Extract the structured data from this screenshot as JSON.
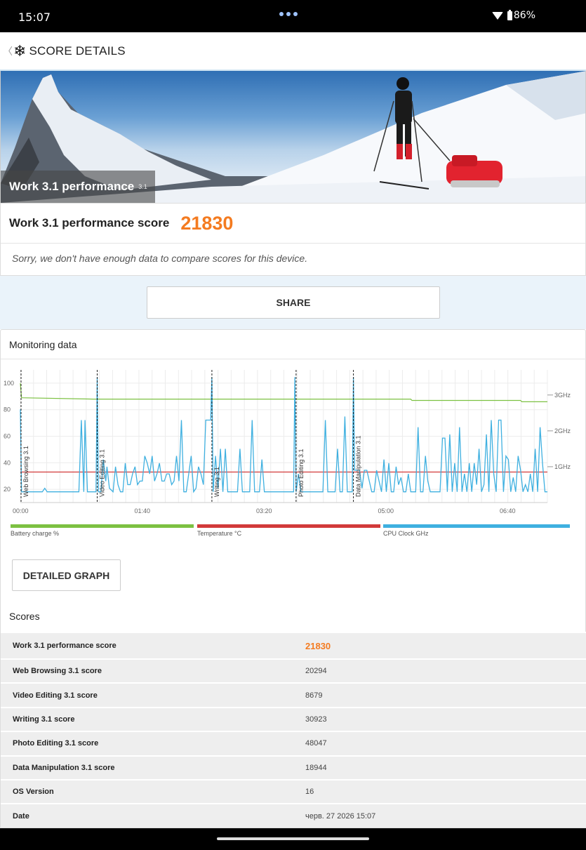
{
  "status": {
    "time": "15:07",
    "battery": "86%"
  },
  "header": {
    "title": "SCORE DETAILS"
  },
  "hero": {
    "title": "Work 3.1 performance",
    "version": "3.1"
  },
  "score": {
    "label": "Work 3.1 performance score",
    "value": "21830",
    "note": "Sorry, we don't have enough data to compare scores for this device."
  },
  "share": {
    "label": "SHARE"
  },
  "monitoring": {
    "title": "Monitoring data",
    "detailed_label": "DETAILED GRAPH"
  },
  "legend": [
    {
      "label": "Battery charge %",
      "color": "#7cc142"
    },
    {
      "label": "Temperature °C",
      "color": "#d23a3a"
    },
    {
      "label": "CPU Clock GHz",
      "color": "#3fb0e0"
    }
  ],
  "chart_data": {
    "type": "line",
    "x_ticks": [
      "00:00",
      "01:40",
      "03:20",
      "05:00",
      "06:40"
    ],
    "x_tick_seconds": [
      0,
      100,
      200,
      300,
      400
    ],
    "xlim": [
      0,
      432
    ],
    "ylim_left": [
      10,
      110
    ],
    "y_ticks_left": [
      20,
      40,
      60,
      80,
      100
    ],
    "y_ticks_right": [
      "1GHz",
      "2GHz",
      "3GHz"
    ],
    "y_ticks_right_values": [
      1,
      2,
      3
    ],
    "ylim_right": [
      0,
      3.7
    ],
    "sections": [
      {
        "name": "Web Browsing 3.1",
        "t": 0
      },
      {
        "name": "Video Editing 3.1",
        "t": 63
      },
      {
        "name": "Writing 3.1",
        "t": 157
      },
      {
        "name": "Photo Editing 3.1",
        "t": 226
      },
      {
        "name": "Data Manipulation 3.1",
        "t": 273
      }
    ],
    "series": [
      {
        "name": "Battery charge %",
        "color": "#7cc142",
        "axis": "left",
        "points": [
          [
            0,
            100
          ],
          [
            1,
            89
          ],
          [
            60,
            88
          ],
          [
            320,
            88
          ],
          [
            321,
            87
          ],
          [
            410,
            87
          ],
          [
            411,
            86
          ],
          [
            432,
            86
          ]
        ]
      },
      {
        "name": "Temperature °C",
        "color": "#d23a3a",
        "axis": "left",
        "points": [
          [
            0,
            33
          ],
          [
            432,
            33
          ]
        ]
      },
      {
        "name": "CPU Clock GHz",
        "color": "#3fb0e0",
        "axis": "right",
        "points": [
          [
            0,
            2.6
          ],
          [
            1,
            0.3
          ],
          [
            18,
            0.3
          ],
          [
            20,
            0.4
          ],
          [
            22,
            0.3
          ],
          [
            48,
            0.3
          ],
          [
            50,
            2.3
          ],
          [
            52,
            0.3
          ],
          [
            53,
            2.3
          ],
          [
            55,
            0.3
          ],
          [
            62,
            0.3
          ],
          [
            63,
            3.5
          ],
          [
            64,
            0.3
          ],
          [
            66,
            0.3
          ],
          [
            68,
            1.2
          ],
          [
            70,
            0.6
          ],
          [
            71,
            1.0
          ],
          [
            73,
            0.4
          ],
          [
            76,
            0.3
          ],
          [
            78,
            1.0
          ],
          [
            80,
            0.5
          ],
          [
            82,
            0.3
          ],
          [
            84,
            0.3
          ],
          [
            86,
            1.1
          ],
          [
            88,
            0.5
          ],
          [
            90,
            0.5
          ],
          [
            92,
            0.8
          ],
          [
            94,
            1.0
          ],
          [
            96,
            0.5
          ],
          [
            98,
            0.6
          ],
          [
            100,
            0.6
          ],
          [
            102,
            1.3
          ],
          [
            104,
            1.1
          ],
          [
            106,
            0.8
          ],
          [
            108,
            1.3
          ],
          [
            110,
            0.6
          ],
          [
            112,
            0.8
          ],
          [
            114,
            1.1
          ],
          [
            116,
            0.6
          ],
          [
            118,
            0.6
          ],
          [
            120,
            0.8
          ],
          [
            122,
            0.8
          ],
          [
            124,
            0.5
          ],
          [
            126,
            0.6
          ],
          [
            128,
            1.3
          ],
          [
            130,
            0.6
          ],
          [
            132,
            2.3
          ],
          [
            134,
            0.3
          ],
          [
            136,
            0.3
          ],
          [
            138,
            0.8
          ],
          [
            140,
            1.3
          ],
          [
            142,
            0.3
          ],
          [
            144,
            0.4
          ],
          [
            146,
            1.0
          ],
          [
            148,
            0.8
          ],
          [
            150,
            0.5
          ],
          [
            152,
            2.3
          ],
          [
            154,
            2.3
          ],
          [
            156,
            2.3
          ],
          [
            157,
            3.5
          ],
          [
            158,
            0.3
          ],
          [
            160,
            1.3
          ],
          [
            162,
            0.4
          ],
          [
            164,
            1.5
          ],
          [
            166,
            0.3
          ],
          [
            168,
            1.5
          ],
          [
            170,
            0.3
          ],
          [
            178,
            0.3
          ],
          [
            180,
            1.5
          ],
          [
            182,
            0.3
          ],
          [
            188,
            0.3
          ],
          [
            190,
            2.3
          ],
          [
            192,
            0.3
          ],
          [
            194,
            0.3
          ],
          [
            196,
            0.3
          ],
          [
            198,
            1.2
          ],
          [
            200,
            0.3
          ],
          [
            224,
            0.3
          ],
          [
            225,
            3.5
          ],
          [
            226,
            0.3
          ],
          [
            228,
            0.8
          ],
          [
            230,
            0.3
          ],
          [
            248,
            0.3
          ],
          [
            250,
            2.3
          ],
          [
            252,
            0.3
          ],
          [
            258,
            0.3
          ],
          [
            260,
            1.5
          ],
          [
            262,
            0.3
          ],
          [
            264,
            0.3
          ],
          [
            266,
            2.4
          ],
          [
            268,
            0.3
          ],
          [
            272,
            0.3
          ],
          [
            273,
            3.5
          ],
          [
            274,
            0.9
          ],
          [
            276,
            0.9
          ],
          [
            278,
            0.9
          ],
          [
            280,
            0.4
          ],
          [
            282,
            0.9
          ],
          [
            284,
            0.9
          ],
          [
            286,
            0.6
          ],
          [
            288,
            0.3
          ],
          [
            290,
            0.3
          ],
          [
            292,
            0.9
          ],
          [
            294,
            0.6
          ],
          [
            296,
            0.3
          ],
          [
            298,
            1.2
          ],
          [
            300,
            0.3
          ],
          [
            302,
            1.1
          ],
          [
            304,
            0.3
          ],
          [
            306,
            0.3
          ],
          [
            308,
            1.0
          ],
          [
            310,
            0.5
          ],
          [
            312,
            0.7
          ],
          [
            314,
            0.3
          ],
          [
            316,
            0.3
          ],
          [
            318,
            0.8
          ],
          [
            320,
            0.3
          ],
          [
            324,
            0.3
          ],
          [
            326,
            2.1
          ],
          [
            328,
            0.3
          ],
          [
            330,
            0.3
          ],
          [
            332,
            1.3
          ],
          [
            334,
            0.6
          ],
          [
            336,
            0.3
          ],
          [
            344,
            0.3
          ],
          [
            346,
            1.8
          ],
          [
            348,
            1.8
          ],
          [
            350,
            0.3
          ],
          [
            352,
            1.9
          ],
          [
            354,
            0.3
          ],
          [
            356,
            1.1
          ],
          [
            358,
            0.3
          ],
          [
            360,
            2.1
          ],
          [
            362,
            0.3
          ],
          [
            364,
            0.8
          ],
          [
            366,
            0.3
          ],
          [
            368,
            1.1
          ],
          [
            370,
            0.3
          ],
          [
            372,
            1.1
          ],
          [
            374,
            0.5
          ],
          [
            376,
            1.5
          ],
          [
            378,
            0.3
          ],
          [
            380,
            0.5
          ],
          [
            382,
            1.9
          ],
          [
            384,
            0.3
          ],
          [
            386,
            2.3
          ],
          [
            388,
            0.8
          ],
          [
            390,
            0.3
          ],
          [
            392,
            2.3
          ],
          [
            394,
            2.3
          ],
          [
            396,
            0.3
          ],
          [
            398,
            1.3
          ],
          [
            400,
            1.2
          ],
          [
            402,
            0.3
          ],
          [
            404,
            0.7
          ],
          [
            406,
            0.3
          ],
          [
            408,
            1.3
          ],
          [
            410,
            0.9
          ],
          [
            412,
            0.3
          ],
          [
            414,
            0.5
          ],
          [
            416,
            0.3
          ],
          [
            418,
            0.8
          ],
          [
            420,
            0.3
          ],
          [
            422,
            1.5
          ],
          [
            424,
            0.3
          ],
          [
            426,
            2.1
          ],
          [
            428,
            1.1
          ],
          [
            430,
            0.3
          ],
          [
            432,
            0.3
          ]
        ]
      }
    ]
  },
  "scores": {
    "title": "Scores",
    "rows": [
      {
        "label": "Work 3.1 performance score",
        "value": "21830"
      },
      {
        "label": "Web Browsing 3.1 score",
        "value": "20294"
      },
      {
        "label": "Video Editing 3.1 score",
        "value": "8679"
      },
      {
        "label": "Writing 3.1 score",
        "value": "30923"
      },
      {
        "label": "Photo Editing 3.1 score",
        "value": "48047"
      },
      {
        "label": "Data Manipulation 3.1 score",
        "value": "18944"
      },
      {
        "label": "OS Version",
        "value": "16"
      },
      {
        "label": "Date",
        "value": "черв. 27 2026 15:07"
      }
    ]
  }
}
